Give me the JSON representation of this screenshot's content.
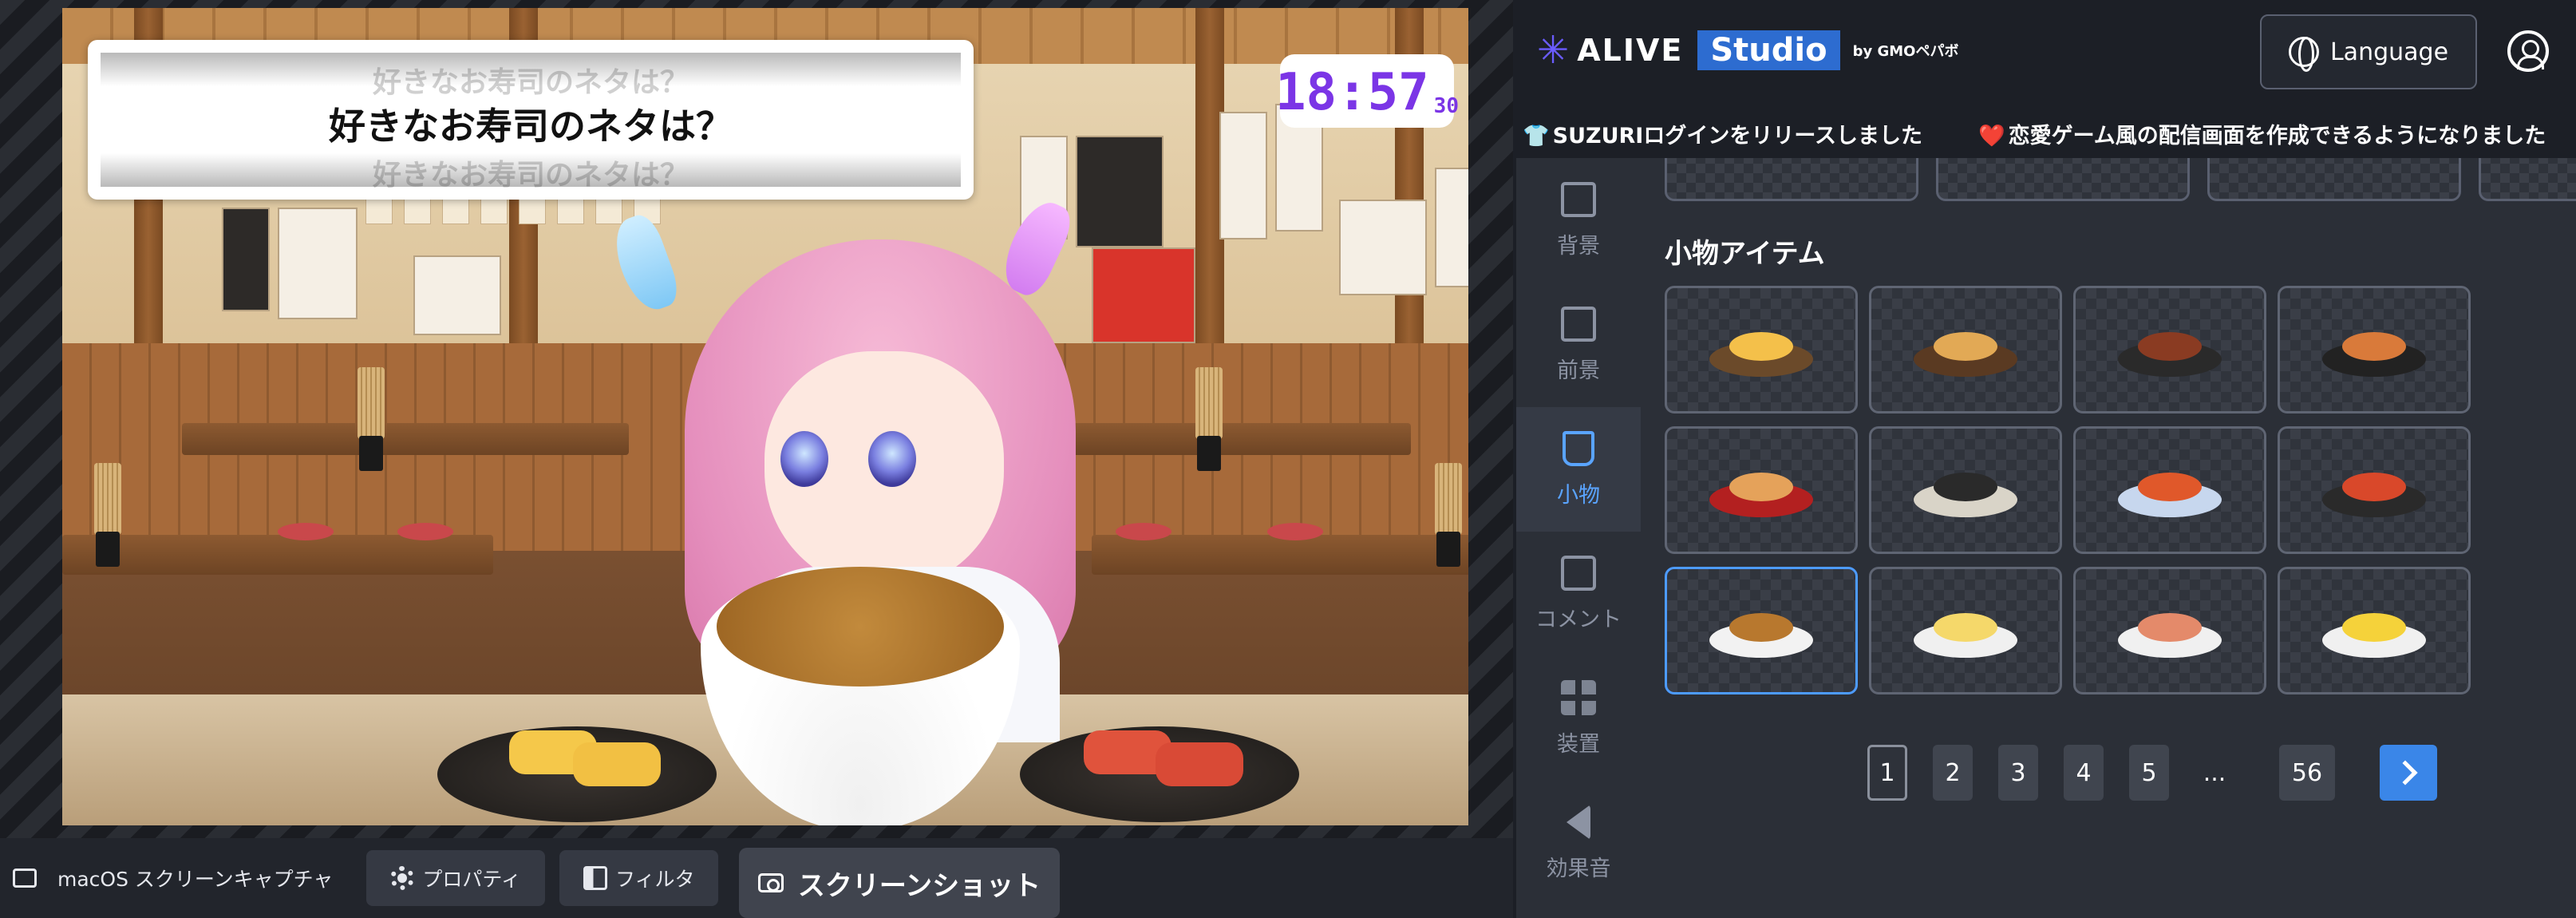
{
  "stage": {
    "question_text": "好きなお寿司のネタは？",
    "question_ghost": "好きなお寿司のネタは？",
    "clock": {
      "main": "18:57",
      "seconds": "30"
    }
  },
  "source_bar": {
    "source_name": "macOS スクリーンキャプチャ",
    "properties_label": "プロパティ",
    "filter_label": "フィルタ"
  },
  "header": {
    "logo_text": "ALIVE",
    "logo_studio": "Studio",
    "logo_by": "by GMOペパボ",
    "language_label": "Language"
  },
  "ticker": [
    {
      "icon": "👕",
      "text": "SUZURIログインをリリースしました"
    },
    {
      "icon": "❤️",
      "text": "恋愛ゲーム風の配信画面を作成できるようになりました"
    }
  ],
  "sidebar": {
    "items": [
      {
        "label": "背景",
        "icon": "image-icon",
        "active": false
      },
      {
        "label": "前景",
        "icon": "image-plus-icon",
        "active": false
      },
      {
        "label": "小物",
        "icon": "cup-icon",
        "active": true
      },
      {
        "label": "コメント",
        "icon": "comment-icon",
        "active": false
      },
      {
        "label": "装置",
        "icon": "widgets-icon",
        "active": false
      },
      {
        "label": "効果音",
        "icon": "speaker-icon",
        "active": false
      }
    ]
  },
  "content": {
    "section_title": "小物アイテム",
    "items": [
      {
        "name": "egg-pan",
        "colors": [
          "#6b4a2a",
          "#f4c04a"
        ]
      },
      {
        "name": "fried-rice-pan",
        "colors": [
          "#5a3a22",
          "#e2a955"
        ]
      },
      {
        "name": "steak-pan",
        "colors": [
          "#2a2a2a",
          "#8a3b22"
        ]
      },
      {
        "name": "bibimbap-bowl",
        "colors": [
          "#222222",
          "#d97a3a"
        ]
      },
      {
        "name": "takoyaki-tray",
        "colors": [
          "#b32020",
          "#e5a25a"
        ]
      },
      {
        "name": "sushi-roll-plate",
        "colors": [
          "#d9d4c8",
          "#2a2a2a"
        ]
      },
      {
        "name": "shrimp-chili-plate",
        "colors": [
          "#c7d7ee",
          "#e0582a"
        ]
      },
      {
        "name": "cheese-hotpot",
        "colors": [
          "#2a2a2a",
          "#d9482a"
        ]
      },
      {
        "name": "natto-rice-bowl",
        "colors": [
          "#f2f2f2",
          "#b8782e"
        ],
        "selected": true
      },
      {
        "name": "tamagoyaki-plate",
        "colors": [
          "#f0f0f0",
          "#f5d86a"
        ]
      },
      {
        "name": "grilled-salmon-plate",
        "colors": [
          "#f0f0f0",
          "#e48a6a"
        ]
      },
      {
        "name": "salmon-radish-plate",
        "colors": [
          "#f0f0f0",
          "#f5d23a"
        ]
      }
    ],
    "pagination": {
      "pages": [
        "1",
        "2",
        "3",
        "4",
        "5"
      ],
      "ellipsis": "...",
      "last": "56",
      "current": "1"
    },
    "screenshot_label": "スクリーンショット"
  }
}
